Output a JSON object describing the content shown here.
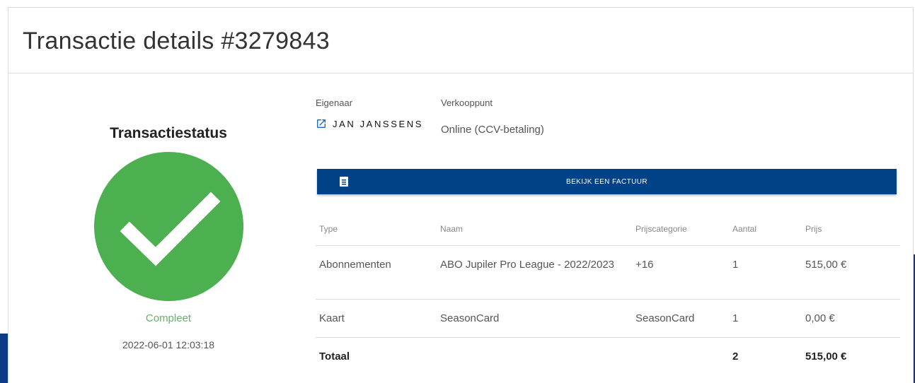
{
  "header": {
    "title": "Transactie details #3279843"
  },
  "status": {
    "title": "Transactiestatus",
    "icon": "check-circle-icon",
    "label": "Compleet",
    "datetime": "2022-06-01 12:03:18",
    "color": "#4caf50"
  },
  "owner": {
    "label": "Eigenaar",
    "name": "JAN JANSSENS",
    "icon": "external-link-icon"
  },
  "point_of_sale": {
    "label": "Verkooppunt",
    "value": "Online (CCV-betaling)"
  },
  "invoice_button": {
    "label": "BEKIJK EEN FACTUUR",
    "icon": "document-icon",
    "color": "#004287"
  },
  "table": {
    "headers": [
      "Type",
      "Naam",
      "Prijscategorie",
      "Aantal",
      "Prijs"
    ],
    "rows": [
      {
        "type": "Abonnementen",
        "name": "ABO Jupiler Pro League - 2022/2023",
        "category": "+16",
        "quantity": "1",
        "price": "515,00 €"
      },
      {
        "type": "Kaart",
        "name": "SeasonCard",
        "category": "SeasonCard",
        "quantity": "1",
        "price": "0,00 €"
      }
    ],
    "total": {
      "label": "Totaal",
      "quantity": "2",
      "price": "515,00 €"
    }
  }
}
